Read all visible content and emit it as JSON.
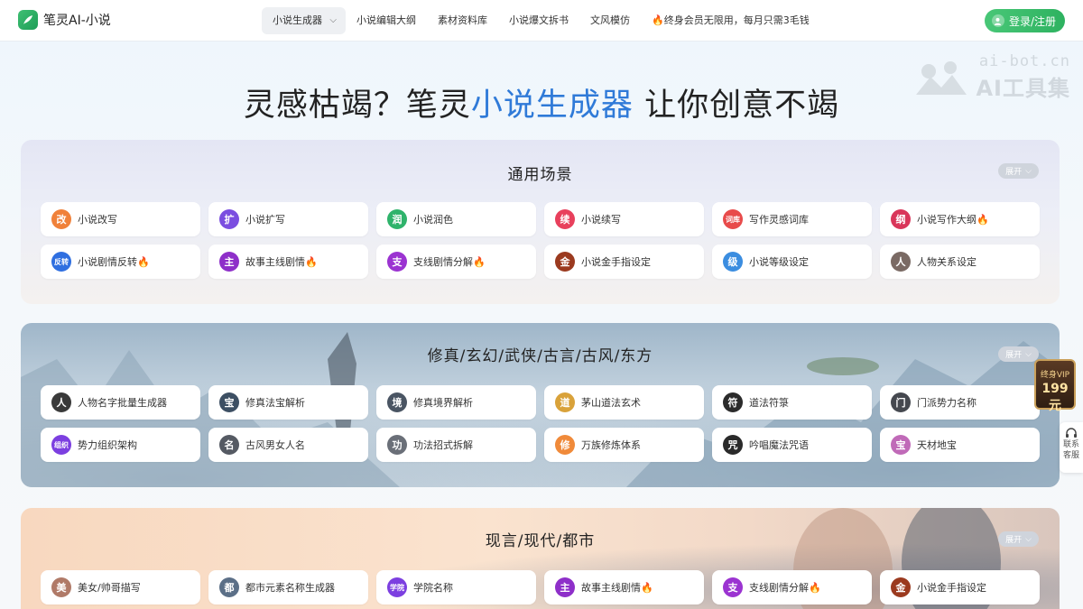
{
  "header": {
    "logo_text": "笔灵AI-小说",
    "nav": [
      {
        "label": "小说生成器",
        "active": true
      },
      {
        "label": "小说编辑大纲"
      },
      {
        "label": "素材资料库"
      },
      {
        "label": "小说爆文拆书"
      },
      {
        "label": "文风模仿"
      },
      {
        "label": "🔥终身会员无限用，每月只需3毛钱"
      }
    ],
    "login_label": "登录/注册"
  },
  "watermark": {
    "url": "ai-bot.cn",
    "name": "AI工具集"
  },
  "hero": {
    "prefix": "灵感枯竭？笔灵",
    "highlight": "小说生成器",
    "suffix": " 让你创意不竭"
  },
  "expand_label": "展开",
  "sections": [
    {
      "title": "通用场景",
      "items": [
        {
          "label": "小说改写",
          "icon": "改",
          "color": "#f0813a"
        },
        {
          "label": "小说扩写",
          "icon": "扩",
          "color": "#7b4ee0"
        },
        {
          "label": "小说润色",
          "icon": "润",
          "color": "#2fb36b"
        },
        {
          "label": "小说续写",
          "icon": "续",
          "color": "#e8405c"
        },
        {
          "label": "写作灵感词库",
          "icon": "词库",
          "color": "#e84b4b"
        },
        {
          "label": "小说写作大纲🔥",
          "icon": "纲",
          "color": "#d9365a"
        },
        {
          "label": "小说剧情反转🔥",
          "icon": "反转",
          "color": "#2f6fe0"
        },
        {
          "label": "故事主线剧情🔥",
          "icon": "主",
          "color": "#8e2fc9"
        },
        {
          "label": "支线剧情分解🔥",
          "icon": "支",
          "color": "#9b33d1"
        },
        {
          "label": "小说金手指设定",
          "icon": "金",
          "color": "#9b3a1f"
        },
        {
          "label": "小说等级设定",
          "icon": "级",
          "color": "#3b8de0"
        },
        {
          "label": "人物关系设定",
          "icon": "人",
          "color": "#7a6a64"
        }
      ]
    },
    {
      "title": "修真/玄幻/武侠/古言/古风/东方",
      "items": [
        {
          "label": "人物名字批量生成器",
          "icon": "人",
          "color": "#3a3a3a"
        },
        {
          "label": "修真法宝解析",
          "icon": "宝",
          "color": "#3d4f63"
        },
        {
          "label": "修真境界解析",
          "icon": "境",
          "color": "#4a5563"
        },
        {
          "label": "茅山道法玄术",
          "icon": "道",
          "color": "#d9a23a"
        },
        {
          "label": "道法符箓",
          "icon": "符",
          "color": "#2b2b2b"
        },
        {
          "label": "门派势力名称",
          "icon": "门",
          "color": "#45484f"
        },
        {
          "label": "势力组织架构",
          "icon": "组织",
          "color": "#7c3fe0"
        },
        {
          "label": "古风男女人名",
          "icon": "名",
          "color": "#555a63"
        },
        {
          "label": "功法招式拆解",
          "icon": "功",
          "color": "#6a6f78"
        },
        {
          "label": "万族修炼体系",
          "icon": "修",
          "color": "#f08a3a"
        },
        {
          "label": "吟唱魔法咒语",
          "icon": "咒",
          "color": "#2a2a2a"
        },
        {
          "label": "天材地宝",
          "icon": "宝",
          "color": "#c06ab8"
        }
      ]
    },
    {
      "title": "现言/现代/都市",
      "items": [
        {
          "label": "美女/帅哥描写",
          "icon": "美",
          "color": "#b07a68"
        },
        {
          "label": "都市元素名称生成器",
          "icon": "都",
          "color": "#5b6f87"
        },
        {
          "label": "学院名称",
          "icon": "学院",
          "color": "#7c3fe0"
        },
        {
          "label": "故事主线剧情🔥",
          "icon": "主",
          "color": "#8e2fc9"
        },
        {
          "label": "支线剧情分解🔥",
          "icon": "支",
          "color": "#9b33d1"
        },
        {
          "label": "小说金手指设定",
          "icon": "金",
          "color": "#9b3a1f"
        }
      ]
    }
  ],
  "vip_badge": {
    "top": "终身VIP",
    "price": "199元"
  },
  "contact": {
    "line1": "联系",
    "line2": "客服"
  }
}
